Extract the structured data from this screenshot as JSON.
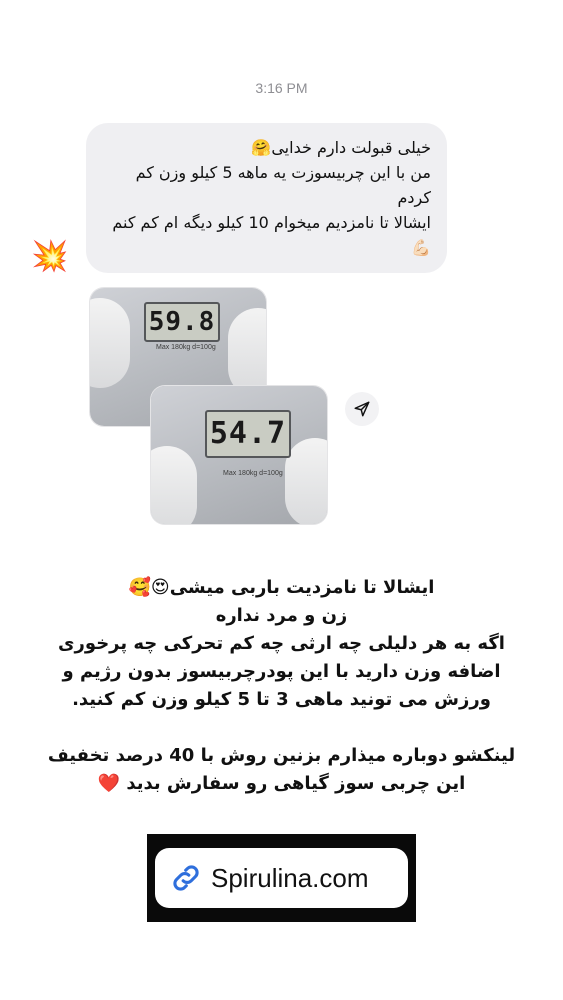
{
  "message": {
    "timestamp": "3:16 PM",
    "lines": [
      "خیلی قبولت دارم خدایی🤗",
      "من با این چربیسوزت یه ماهه 5 کیلو وزن کم کردم",
      "ایشالا تا نامزدیم میخوام 10 کیلو دیگه ام کم کنم 💪🏻"
    ],
    "reaction": "💥"
  },
  "photos": {
    "scale_before": "59.8",
    "scale_after": "54.7",
    "scale_caption": "Max 180kg  d=100g"
  },
  "caption": {
    "lines": [
      "ایشالا تا نامزدیت باربی میشی😍🥰",
      "زن و مرد نداره",
      "اگه به هر دلیلی چه ارثی چه کم تحرکی چه پرخوری",
      "اضافه وزن دارید با این پودرچربیسوز بدون رژیم و",
      "ورزش می تونید ماهی 3 تا 5 کیلو وزن کم کنید."
    ],
    "lines2": [
      "لینکشو دوباره میذارم بزنین روش با 40 درصد تخفیف",
      "این چربی سوز گیاهی رو سفارش بدید ❤️"
    ]
  },
  "link_sticker": {
    "text": "Spirulina.com",
    "icon": "link-icon"
  },
  "colors": {
    "bubble_bg": "#efeff2",
    "timestamp": "#8e8e93",
    "sticker_bg": "#0a0a0a",
    "link_icon": "#2f6fdc"
  }
}
